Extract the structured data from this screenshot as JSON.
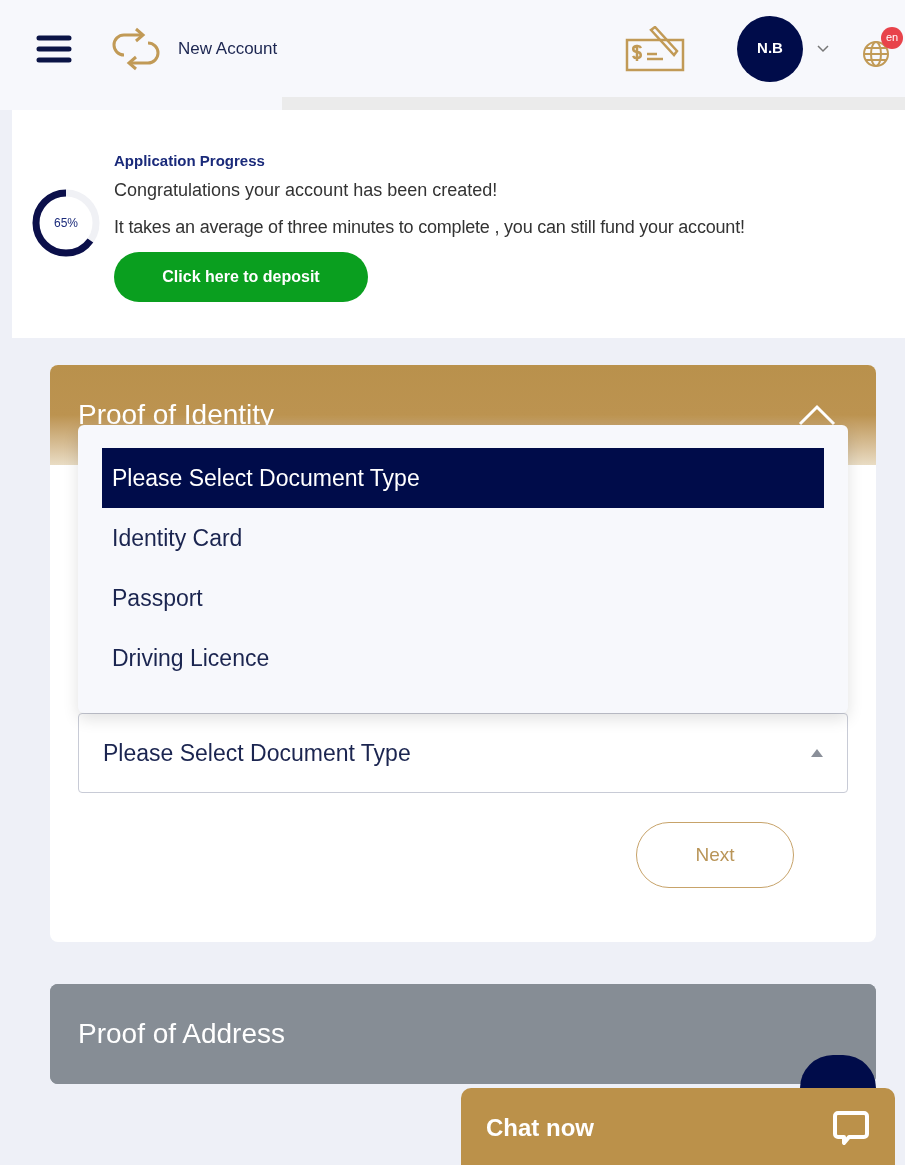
{
  "header": {
    "title": "New Account",
    "avatar": "N.B",
    "language_badge": "en"
  },
  "progress": {
    "title": "Application Progress",
    "level": 0.65,
    "reading": "65%",
    "message": "Congratulations your account has been created!",
    "note": "It takes an average of three minutes to complete , you can still fund your account!",
    "button": "Click here to deposit"
  },
  "sections": [
    {
      "title": "Proof of Identity",
      "expanded": true,
      "dropdown": {
        "open": true,
        "options": [
          {
            "label": "Please Select Document Type",
            "selected": true
          },
          {
            "label": "Identity Card",
            "selected": false
          },
          {
            "label": "Passport",
            "selected": false
          },
          {
            "label": "Driving Licence",
            "selected": false
          }
        ],
        "value": "Please Select Document Type"
      },
      "button": "Next"
    },
    {
      "title": "Proof of Address",
      "expanded": false
    }
  ],
  "chat": {
    "label": "Chat now"
  }
}
